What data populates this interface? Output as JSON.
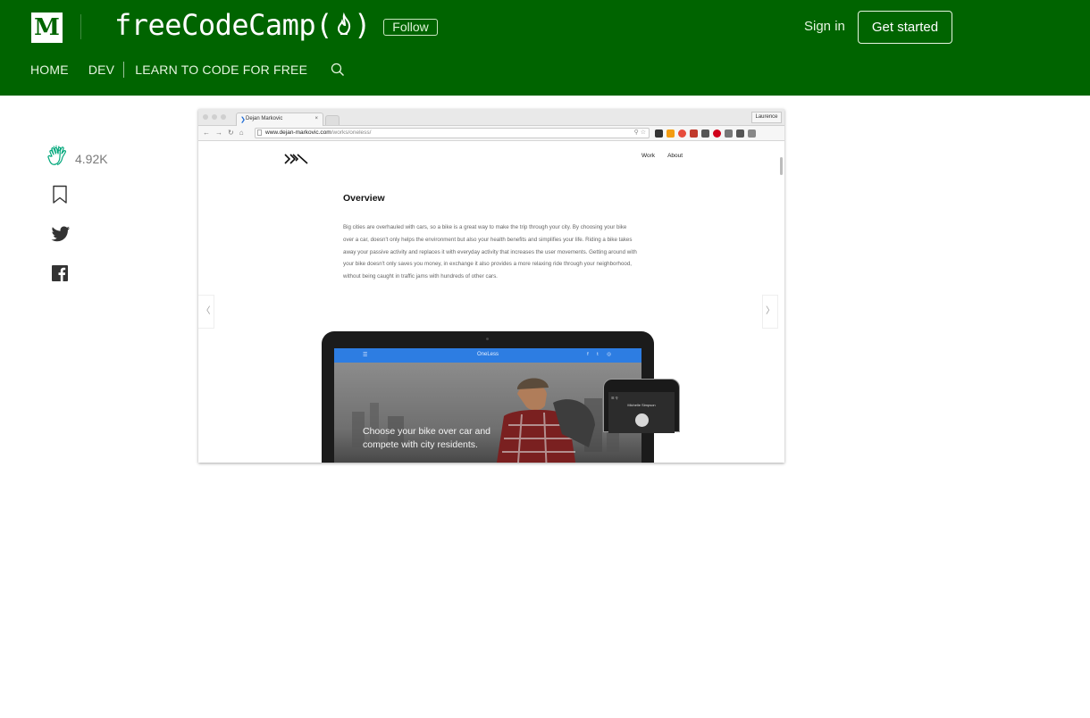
{
  "header": {
    "medium_logo": "M",
    "brand": "freeCodeCamp(",
    "brand_close": ")",
    "follow": "Follow",
    "sign_in": "Sign in",
    "get_started": "Get started",
    "nav": [
      "HOME",
      "DEV",
      "LEARN TO CODE FOR FREE"
    ],
    "bg_color": "#006400"
  },
  "sidebar": {
    "clap_count": "4.92K",
    "clap_color": "#03a87c"
  },
  "screenshot": {
    "tab_title": "Dejan Markovic",
    "tab_close": "×",
    "user": "Laurence",
    "url_host": "www.dejan-markovic.com",
    "url_path": "/works/oneless/",
    "site_nav": [
      "Work",
      "About"
    ],
    "overview_title": "Overview",
    "overview_body": "Big cities are overhauled with cars, so a bike is a great way to make the trip through your city. By choosing your bike over a car, doesn't only helps the environment but also your health benefits and simplifies your life. Riding a bike takes away your passive activity and replaces it with everyday activity that increases the user movements. Getting around with your bike doesn't only saves you money, in exchange it also provides a more relaxing ride through your neighborhood, without being caught in traffic jams with hundreds of other cars.",
    "arrow_left": "〈",
    "arrow_right": "〉",
    "app_title": "OneLess",
    "app_social": "f t ◎",
    "app_tagline_1": "Choose your bike over car and",
    "app_tagline_2": "compete with city residents.",
    "phone_name": "Michelle Simpson"
  }
}
